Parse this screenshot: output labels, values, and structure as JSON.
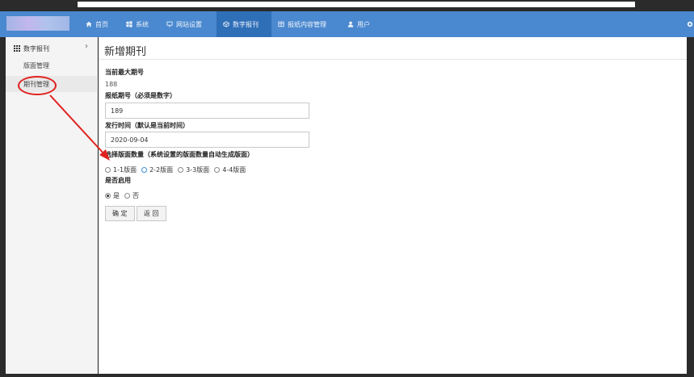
{
  "nav": {
    "items": [
      {
        "label": "首页",
        "icon": "home-icon"
      },
      {
        "label": "系统",
        "icon": "windows-icon"
      },
      {
        "label": "网站设置",
        "icon": "monitor-icon"
      },
      {
        "label": "数字报刊",
        "icon": "cube-icon"
      },
      {
        "label": "报纸内容管理",
        "icon": "table-icon"
      },
      {
        "label": "用户",
        "icon": "user-icon"
      }
    ],
    "active_index": 3,
    "bar_color": "#4a88cf",
    "active_color": "#2f6fb8"
  },
  "sidebar": {
    "header": "数字报刊",
    "items": [
      {
        "label": "版面管理"
      },
      {
        "label": "期刊管理"
      }
    ]
  },
  "main": {
    "title": "新增期刊",
    "current_max_label": "当前最大期号",
    "current_max_value": "188",
    "issue_label": "报纸期号（必须是数字）",
    "issue_value": "189",
    "date_label": "发行时间（默认是当前时间）",
    "date_value": "2020-09-04",
    "pages_label": "选择版面数量（系统设置的版面数量自动生成版面）",
    "pages_options": [
      "1-1版面",
      "2-2版面",
      "3-3版面",
      "4-4版面"
    ],
    "enabled_label": "是否启用",
    "enabled_options": [
      "是",
      "否"
    ],
    "enabled_selected": "是",
    "confirm_button": "确 定",
    "back_button": "返 回"
  },
  "annotation_color": "#e0211e"
}
